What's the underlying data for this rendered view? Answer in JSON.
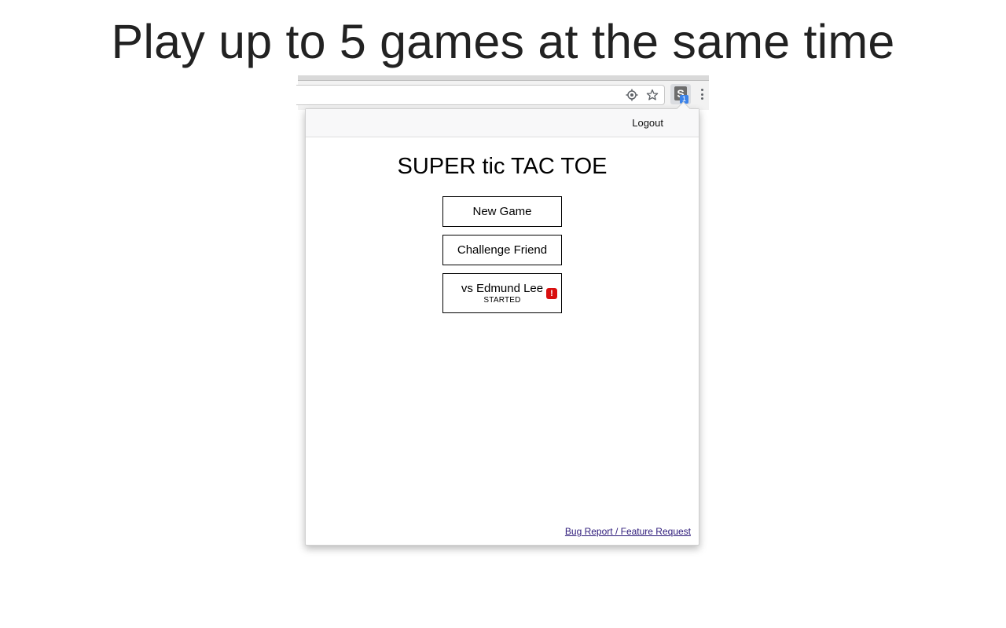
{
  "headline": "Play up to 5 games at the same time",
  "browser": {
    "omnibox_icons": [
      "location-target-icon",
      "star-bookmark-icon"
    ],
    "extension": {
      "logo_letter": "S",
      "badge_count": "1"
    },
    "menu_icon": "vertical-dots-menu-icon"
  },
  "popup": {
    "header": {
      "logout_label": "Logout"
    },
    "title": "SUPER tic TAC TOE",
    "buttons": {
      "new_game": "New Game",
      "challenge_friend": "Challenge Friend"
    },
    "games": [
      {
        "opponent": "vs Edmund Lee",
        "status": "STARTED",
        "alert": "!"
      }
    ],
    "footer_link": "Bug Report / Feature Request"
  },
  "colors": {
    "alert_badge": "#d90f0f",
    "extension_badge": "#3b82e8",
    "link": "#2d1a7a"
  }
}
